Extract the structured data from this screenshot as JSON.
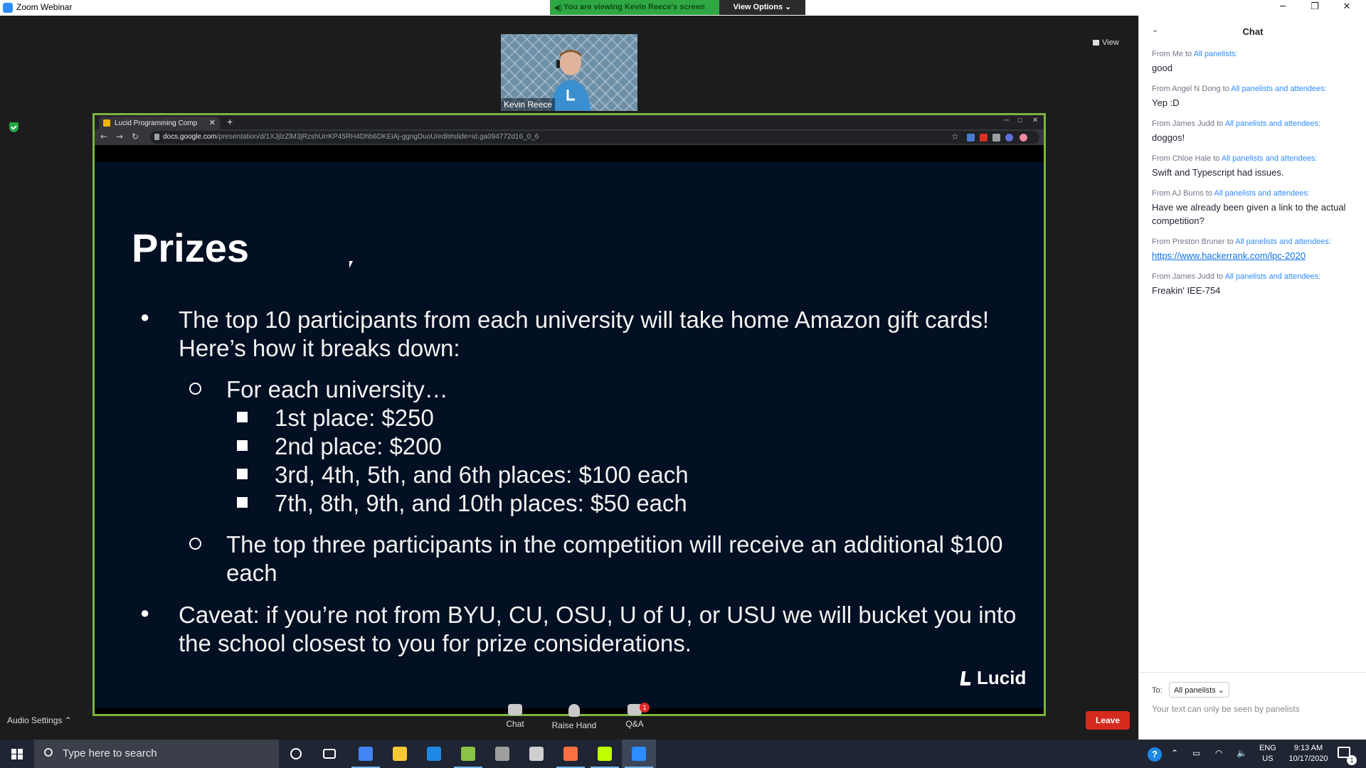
{
  "window": {
    "title": "Zoom Webinar",
    "minimize_glyph": "─",
    "restore_glyph": "❐",
    "close_glyph": "✕"
  },
  "banner": {
    "viewing_text": "You are viewing Kevin Reece's screen",
    "view_options_label": "View Options ⌄",
    "speaker_icon": "speaker-icon"
  },
  "speaker": {
    "name": "Kevin Reece"
  },
  "view_toggle": {
    "label": "View"
  },
  "browser": {
    "tab_title": "Lucid Programming Comp",
    "tab_close": "✕",
    "new_tab": "+",
    "url_host": "docs.google.com",
    "url_path": "/presentation/d/1XJjlzZlM3jRzshUrrKP45RH4Dhb6DKEiAj-ggngDuoU/edit#slide=id.ga094772d16_0_6",
    "nav_back": "←",
    "nav_forward": "→",
    "nav_reload": "↻",
    "star": "☆",
    "win_min": "─",
    "win_max": "□",
    "win_close": "✕"
  },
  "slide": {
    "title": "Prizes",
    "bullet1_line1": "The top 10 participants from each university will take home Amazon gift cards!",
    "bullet1_line2": "Here’s how it breaks down:",
    "sub1": "For each university…",
    "place1": "1st place: $250",
    "place2": "2nd place: $200",
    "place3": "3rd, 4th, 5th, and 6th places: $100 each",
    "place4": "7th, 8th, 9th, and 10th places: $50 each",
    "sub2_line1": "The top three participants in the competition will receive an additional $100",
    "sub2_line2": "each",
    "bullet2_line1": "Caveat: if you’re not from BYU, CU, OSU, U of U, or USU we will bucket you into",
    "bullet2_line2": "the school closest to you for prize considerations.",
    "logo": "Lucid"
  },
  "controls": {
    "audio_settings": "Audio Settings  ⌃",
    "chat": "Chat",
    "raise_hand": "Raise Hand",
    "qa": "Q&A",
    "qa_badge": "1",
    "leave": "Leave"
  },
  "chat": {
    "header": "Chat",
    "collapse": "⌄",
    "messages": [
      {
        "from": "From Me to ",
        "to": "All panelists:",
        "text": "good"
      },
      {
        "from": "From Angel N Dong to ",
        "to": "All panelists and attendees:",
        "text": "Yep :D"
      },
      {
        "from": "From James Judd to ",
        "to": "All panelists and attendees:",
        "text": "doggos!"
      },
      {
        "from": "From Chloe Hale to ",
        "to": "All panelists and attendees:",
        "text": "Swift and Typescript had issues."
      },
      {
        "from": "From AJ Burns to ",
        "to": "All panelists and attendees:",
        "text": "Have we already been given a link to the actual competition?"
      },
      {
        "from": "From Preston Bruner to ",
        "to": "All panelists and attendees:",
        "text": "https://www.hackerrank.com/lpc-2020"
      },
      {
        "from": "From James Judd to ",
        "to": "All panelists and attendees:",
        "text": "Freakin' IEE-754"
      }
    ],
    "to_label": "To:",
    "recipient": "All panelists ⌄",
    "input_hint": "Your text can only be seen by panelists"
  },
  "taskbar": {
    "search_placeholder": "Type here to search",
    "help": "?",
    "language_line1": "ENG",
    "language_line2": "US",
    "time": "9:13 AM",
    "date": "10/17/2020",
    "notifications": "1",
    "app_colors": [
      "#4285f4",
      "#f9c935",
      "#1e88e5",
      "#8bc34a",
      "#9e9e9e",
      "#cfcfcf",
      "#ff7043",
      "#c0ff00",
      "#2d8cff"
    ]
  }
}
